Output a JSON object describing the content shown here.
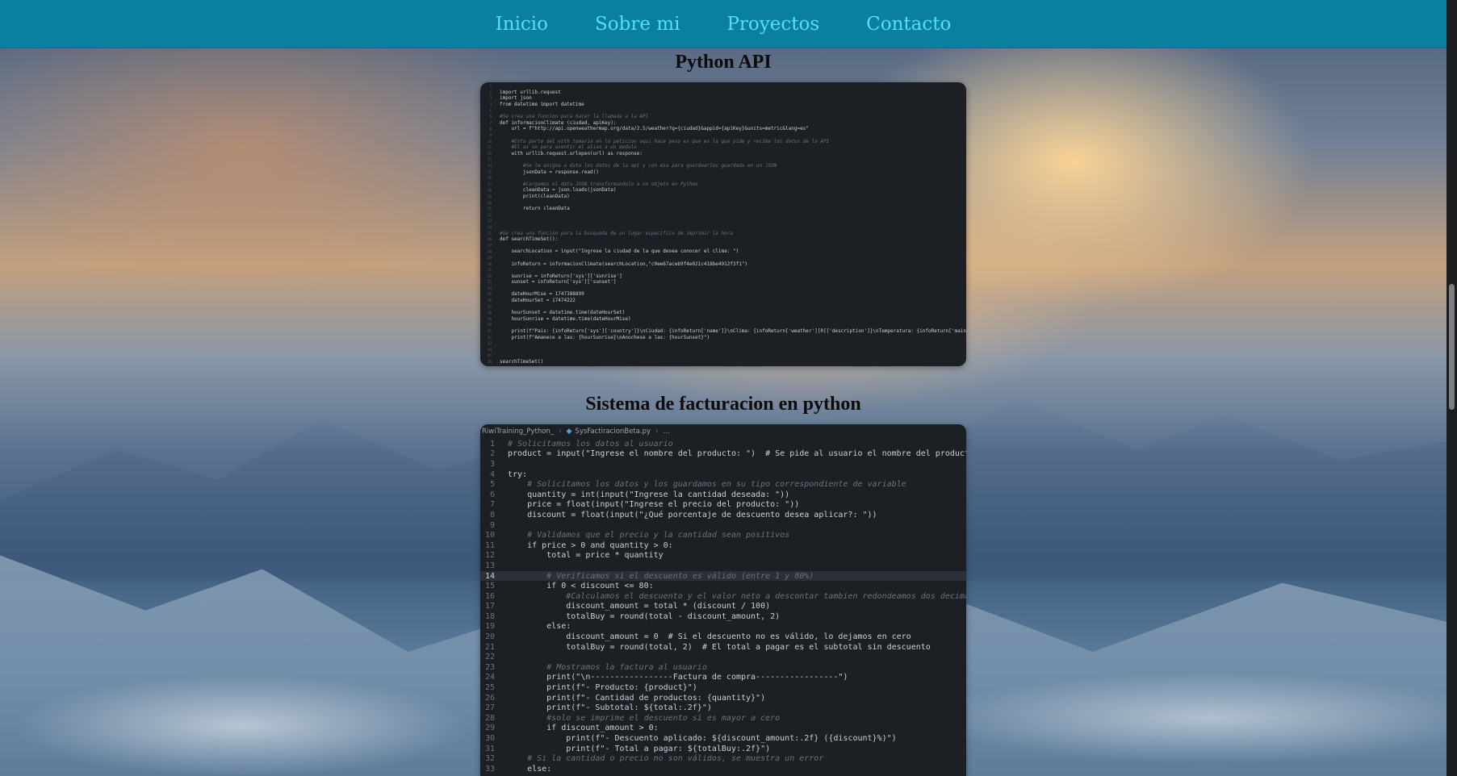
{
  "nav": {
    "items": [
      "Inicio",
      "Sobre mi",
      "Proyectos",
      "Contacto"
    ]
  },
  "sections": [
    {
      "title": "Python API",
      "lines": [
        "",
        "import urllib.request",
        "import json",
        "from datetime import datetime",
        "",
        "#Se crea una funcion para hacer la llamada a la API",
        "def informacionClimate (ciudad, apiKey):",
        "    url = f\"http://api.openweathermap.org/data/2.5/weather?q={ciudad}&appid={apiKey}&units=metric&lang=es\"",
        "",
        "    #Esta parte del with tomaria en la peticion aqui hace peso es que es la que pide y recibe los datos de la API",
        "    #El as se para asentir el alias a un modulo",
        "    with urllib.request.urlopen(url) as response:",
        "",
        "        #Se le asigna a data los datos de la api y con esa para guardaarlos guardada en un JSON",
        "        jsonData = response.read()",
        "",
        "        #Cargamos el data JSON transformandolo a un objeto en Python",
        "        cleanData = json.loads(jsonData)",
        "        print(cleanData)",
        "",
        "        return cleanData",
        "",
        "",
        "",
        "#Se crea una funcion para la busqueda de un lugar especifico de imprimir la hora",
        "def searchTimeSet():",
        "",
        "    searchLocation = input(\"Ingrese la ciudad de la que desea conocer el clima: \")",
        "",
        "    infoReturn = informacionClimate(searchLocation,\"c0ee67ace69f4e021c418be4912f3f1\")",
        "",
        "    sunrise = infoReturn['sys']['sunrise']",
        "    sunset = infoReturn['sys']['sunset']",
        "",
        "    dateHourMise = 1747388899",
        "    dateHourSet = 17474222",
        "",
        "    hourSunset = datetime.time(dateHourSet)",
        "    hourSunrise = datetime.time(dateHourMise)",
        "",
        "    print(f\"Pais: {infoReturn['sys']['country']}\\nCiudad: {infoReturn['name']}\\nClima: {infoReturn['weather'][0]['description']}\\nTemperatura: {infoReturn['main']['temp']}\")",
        "    print(f\"Amanece a las: {hourSunrise}\\nAnochese a las: {hourSunset}\")",
        "",
        "",
        "",
        "searchTimeSet()",
        ""
      ]
    },
    {
      "title": "Sistema de facturacion en python",
      "breadcrumb": {
        "folder": "RiwiTraining_Python_",
        "file": "SysFactiracionBeta.py",
        "more": "..."
      },
      "highlight_line": 14,
      "lines": [
        "# Solicitamos los datos al usuario",
        "product = input(\"Ingrese el nombre del producto: \")  # Se pide al usuario el nombre del producto",
        "",
        "try:",
        "    # Solicitamos los datos y los guardamos en su tipo correspondiente de variable",
        "    quantity = int(input(\"Ingrese la cantidad deseada: \"))",
        "    price = float(input(\"Ingrese el precio del producto: \"))",
        "    discount = float(input(\"¿Qué porcentaje de descuento desea aplicar?: \"))",
        "",
        "    # Validamos que el precio y la cantidad sean positivos",
        "    if price > 0 and quantity > 0:",
        "        total = price * quantity",
        "",
        "        # Verificamos si el descuento es válido (entre 1 y 80%)",
        "        if 0 < discount <= 80:",
        "            #Calculamos el descuento y el valor neto a descontar tambien redondeamos dos decimales",
        "            discount_amount = total * (discount / 100)",
        "            totalBuy = round(total - discount_amount, 2)",
        "        else:",
        "            discount_amount = 0  # Si el descuento no es válido, lo dejamos en cero",
        "            totalBuy = round(total, 2)  # El total a pagar es el subtotal sin descuento",
        "",
        "        # Mostramos la factura al usuario",
        "        print(\"\\n-----------------Factura de compra-----------------\")",
        "        print(f\"- Producto: {product}\")",
        "        print(f\"- Cantidad de productos: {quantity}\")",
        "        print(f\"- Subtotal: ${total:.2f}\")",
        "        #solo se imprime el descuento si es mayor a cero",
        "        if discount_amount > 0:",
        "            print(f\"- Descuento aplicado: ${discount_amount:.2f} ({discount}%)\")",
        "            print(f\"- Total a pagar: ${totalBuy:.2f}\")",
        "    # Si la cantidad o precio no son válidos, se muestra un error",
        "    else:"
      ]
    }
  ]
}
